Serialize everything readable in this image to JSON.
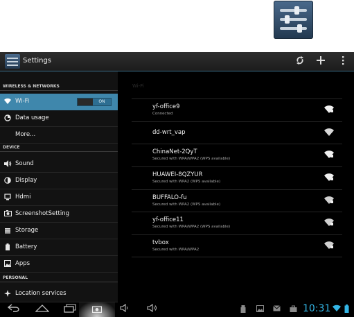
{
  "action_bar": {
    "title": "Settings",
    "icons": [
      "settings-app-icon",
      "sync-icon",
      "add-icon",
      "overflow-menu-icon"
    ]
  },
  "sidebar": {
    "sections": [
      {
        "header": "WIRELESS & NETWORKS"
      },
      {
        "header": "DEVICE"
      },
      {
        "header": "PERSONAL"
      }
    ],
    "items": [
      {
        "label": "Wi-Fi",
        "icon": "wifi-icon",
        "selected": true,
        "toggle": "ON"
      },
      {
        "label": "Data usage",
        "icon": "data-usage-icon"
      },
      {
        "label": "More...",
        "icon": ""
      },
      {
        "label": "Sound",
        "icon": "sound-icon"
      },
      {
        "label": "Display",
        "icon": "display-icon"
      },
      {
        "label": "Hdmi",
        "icon": "hdmi-icon"
      },
      {
        "label": "ScreenshotSetting",
        "icon": "camera-icon"
      },
      {
        "label": "Storage",
        "icon": "storage-icon"
      },
      {
        "label": "Battery",
        "icon": "battery-icon"
      },
      {
        "label": "Apps",
        "icon": "apps-icon"
      },
      {
        "label": "Location services",
        "icon": "location-icon"
      }
    ]
  },
  "wifi": {
    "header": "Wi-Fi",
    "networks": [
      {
        "name": "yf-office9",
        "status": "Connected",
        "secured": true
      },
      {
        "name": "dd-wrt_vap",
        "status": "",
        "secured": false
      },
      {
        "name": "ChinaNet-2QyT",
        "status": "Secured with WPA/WPA2 (WPS available)",
        "secured": true
      },
      {
        "name": "HUAWEI-8QZYUR",
        "status": "Secured with WPA2 (WPS available)",
        "secured": true
      },
      {
        "name": "BUFFALO-fu",
        "status": "Secured with WPA2 (WPS available)",
        "secured": true
      },
      {
        "name": "yf-office11",
        "status": "Secured with WPA/WPA2 (WPS available)",
        "secured": true
      },
      {
        "name": "tvbox",
        "status": "Secured with WPA/WPA2",
        "secured": true
      }
    ]
  },
  "system_bar": {
    "clock": "10:31",
    "buttons": [
      "back-icon",
      "home-icon",
      "recent-apps-icon",
      "screenshot-icon",
      "volume-down-icon",
      "volume-up-icon"
    ],
    "notifications": [
      "usb-icon",
      "gallery-icon",
      "mail-icon",
      "bag-icon"
    ],
    "status_icons": [
      "wifi-status-icon",
      "battery-status-icon"
    ]
  },
  "colors": {
    "accent": "#3f87ac",
    "clock": "#33b5e5",
    "background": "#000000"
  }
}
